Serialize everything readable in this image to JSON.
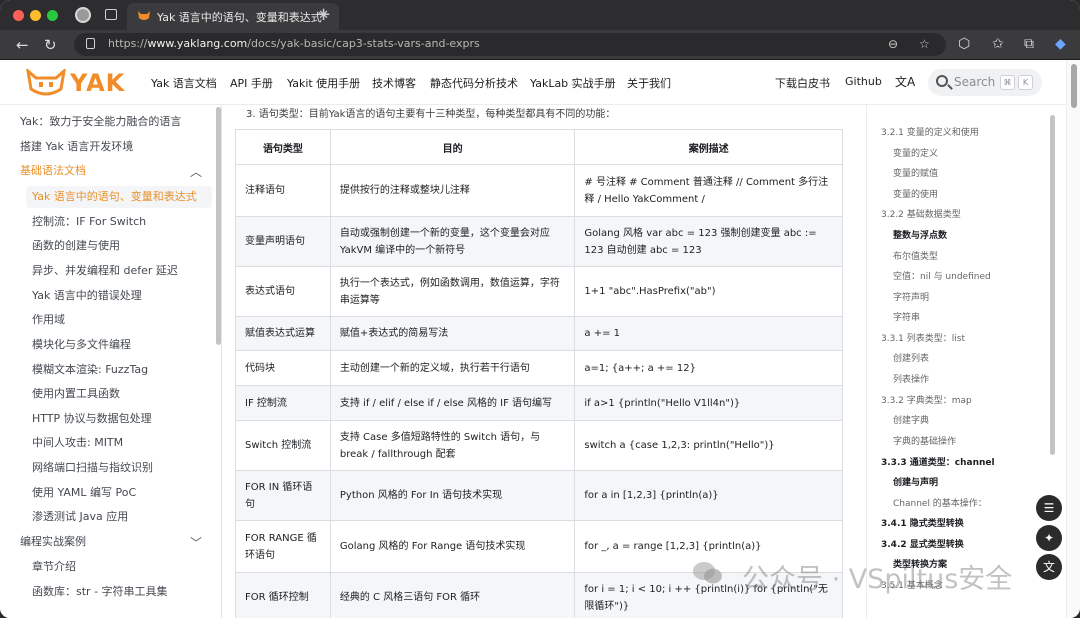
{
  "browser": {
    "tab_title": "Yak 语言中的语句、变量和表达式",
    "url_prefix": "https://",
    "url_host": "www.yaklang.com",
    "url_path": "/docs/yak-basic/cap3-stats-vars-and-exprs"
  },
  "site": {
    "logo_text": "YAK",
    "nav": [
      "Yak 语言文档",
      "API 手册",
      "Yakit 使用手册",
      "技术博客",
      "静态代码分析技术",
      "YakLab 实战手册",
      "关于我们"
    ],
    "nav_right": [
      "下载白皮书",
      "Github"
    ],
    "search_placeholder": "Search",
    "kbd": [
      "⌘",
      "K"
    ]
  },
  "sidebar": {
    "items": [
      {
        "label": "Yak：致力于安全能力融合的语言",
        "level": 0
      },
      {
        "label": "搭建 Yak 语言开发环境",
        "level": 0
      },
      {
        "label": "基础语法文档",
        "level": 0,
        "category": true
      },
      {
        "label": "Yak 语言中的语句、变量和表达式",
        "level": 1,
        "active": true
      },
      {
        "label": "控制流：IF For Switch",
        "level": 1
      },
      {
        "label": "函数的创建与使用",
        "level": 1
      },
      {
        "label": "异步、并发编程和 defer 延迟",
        "level": 1
      },
      {
        "label": "Yak 语言中的错误处理",
        "level": 1
      },
      {
        "label": "作用域",
        "level": 1
      },
      {
        "label": "模块化与多文件编程",
        "level": 1
      },
      {
        "label": "模糊文本渲染: FuzzTag",
        "level": 1
      },
      {
        "label": "使用内置工具函数",
        "level": 1
      },
      {
        "label": "HTTP 协议与数据包处理",
        "level": 1
      },
      {
        "label": "中间人攻击: MITM",
        "level": 1
      },
      {
        "label": "网络端口扫描与指纹识别",
        "level": 1
      },
      {
        "label": "使用 YAML 编写 PoC",
        "level": 1
      },
      {
        "label": "渗透测试 Java 应用",
        "level": 1
      },
      {
        "label": "编程实战案例",
        "level": 0
      },
      {
        "label": "章节介绍",
        "level": 1
      },
      {
        "label": "函数库：str - 字符串工具集",
        "level": 1
      }
    ]
  },
  "main": {
    "intro": "3. 语句类型：目前Yak语言的语句主要有十三种类型，每种类型都具有不同的功能：",
    "table": {
      "headers": [
        "语句类型",
        "目的",
        "案例描述"
      ],
      "rows": [
        [
          "注释语句",
          "提供按行的注释或整块儿注释",
          "# 号注释 # Comment 普通注释 // Comment 多行注释 / Hello YakComment /"
        ],
        [
          "变量声明语句",
          "自动或强制创建一个新的变量，这个变量会对应 YakVM 编译中的一个新符号",
          "Golang 风格 var abc = 123 强制创建变量 abc := 123 自动创建 abc = 123"
        ],
        [
          "表达式语句",
          "执行一个表达式，例如函数调用，数值运算，字符串运算等",
          "1+1 \"abc\".HasPrefix(\"ab\")"
        ],
        [
          "赋值表达式运算",
          "赋值+表达式的简易写法",
          "a += 1"
        ],
        [
          "代码块",
          "主动创建一个新的定义域，执行若干行语句",
          "a=1; {a++; a += 12}"
        ],
        [
          "IF 控制流",
          "支持 if / elif / else if / else 风格的 IF 语句编写",
          "if a>1 {println(\"Hello V1ll4n\")}"
        ],
        [
          "Switch 控制流",
          "支持 Case 多值短路特性的 Switch 语句，与 break / fallthrough 配套",
          "switch a {case 1,2,3: println(\"Hello\")}"
        ],
        [
          "FOR IN 循环语句",
          "Python 风格的 For In 语句技术实现",
          "for a in [1,2,3] {println(a)}"
        ],
        [
          "FOR RANGE 循环语句",
          "Golang 风格的 For Range 语句技术实现",
          "for _, a = range [1,2,3] {println(a)}"
        ],
        [
          "FOR 循环控制",
          "经典的 C 风格三语句 FOR 循环",
          "for i = 1; i < 10; i ++ {println(i)} for {println(\"无限循环\")}"
        ]
      ]
    }
  },
  "toc": {
    "items": [
      {
        "label": "3.2.1 变量的定义和使用",
        "level": 0
      },
      {
        "label": "变量的定义",
        "level": 1
      },
      {
        "label": "变量的赋值",
        "level": 1
      },
      {
        "label": "变量的使用",
        "level": 1
      },
      {
        "label": "3.2.2 基础数据类型",
        "level": 0
      },
      {
        "label": "整数与浮点数",
        "level": 1,
        "bold": true
      },
      {
        "label": "布尔值类型",
        "level": 1
      },
      {
        "label": "空值：nil 与 undefined",
        "level": 1
      },
      {
        "label": "字符声明",
        "level": 1
      },
      {
        "label": "字符串",
        "level": 1
      },
      {
        "label": "3.3.1 列表类型：list",
        "level": 0
      },
      {
        "label": "创建列表",
        "level": 1
      },
      {
        "label": "列表操作",
        "level": 1
      },
      {
        "label": "3.3.2 字典类型：map",
        "level": 0
      },
      {
        "label": "创建字典",
        "level": 1
      },
      {
        "label": "字典的基础操作",
        "level": 1
      },
      {
        "label": "3.3.3 通道类型：channel",
        "level": 0,
        "bold": true
      },
      {
        "label": "创建与声明",
        "level": 1,
        "bold": true
      },
      {
        "label": "Channel 的基本操作：",
        "level": 1
      },
      {
        "label": "3.4.1 隐式类型转换",
        "level": 0,
        "bold": true
      },
      {
        "label": "3.4.2 显式类型转换",
        "level": 0,
        "bold": true
      },
      {
        "label": "类型转换方案",
        "level": 1,
        "bold": true
      },
      {
        "label": "3.5.1 基本概念",
        "level": 0
      }
    ]
  },
  "watermark": "公众号 · VSpiltus安全",
  "colors": {
    "accent": "#e8912b",
    "logo": "#f28c28"
  }
}
